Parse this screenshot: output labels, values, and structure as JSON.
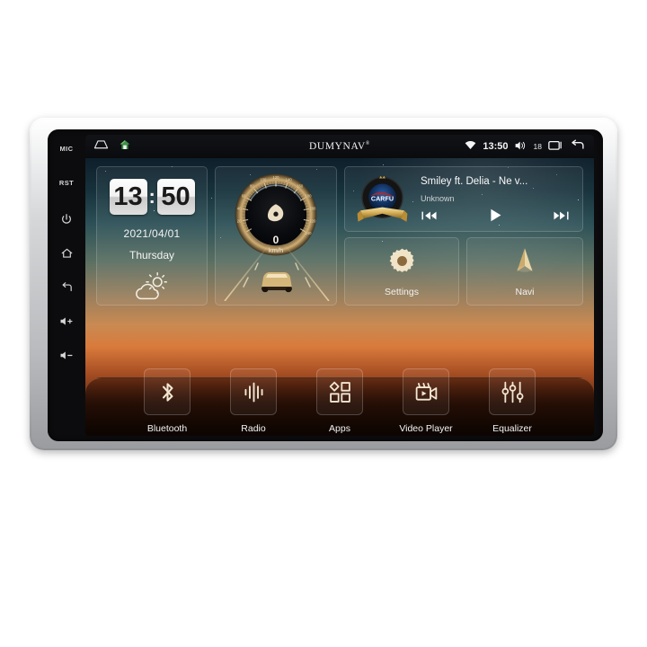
{
  "device": {
    "brand": "DUMYNAV",
    "brand_mark": "®"
  },
  "hardkeys": [
    {
      "name": "mic",
      "label": "MIC"
    },
    {
      "name": "reset",
      "label": "RST"
    },
    {
      "name": "power",
      "label": ""
    },
    {
      "name": "home",
      "label": ""
    },
    {
      "name": "back",
      "label": ""
    },
    {
      "name": "volume-up",
      "label": ""
    },
    {
      "name": "volume-down",
      "label": ""
    }
  ],
  "statusbar": {
    "left_icons": [
      "collapse-icon",
      "home-icon"
    ],
    "time": "13:50",
    "volume_level": "18",
    "right_icons": [
      "wifi-icon",
      "volume-icon",
      "recents-icon",
      "back-icon"
    ]
  },
  "clock_widget": {
    "hours": "13",
    "separator": ":",
    "minutes": "50",
    "date": "2021/04/01",
    "weekday": "Thursday",
    "weather_icon": "partly-cloudy-icon"
  },
  "speed_widget": {
    "value": "0",
    "unit": "km/h",
    "ticks": [
      "20",
      "40",
      "60",
      "80",
      "100",
      "120",
      "140",
      "160",
      "180",
      "200",
      "220",
      "240"
    ],
    "min": 0,
    "max": 240
  },
  "media_widget": {
    "title": "Smiley ft. Delia - Ne v...",
    "artist": "Unknown",
    "album_art_text": "CARFU",
    "controls": [
      {
        "name": "previous-track-button",
        "label": "Previous"
      },
      {
        "name": "play-button",
        "label": "Play"
      },
      {
        "name": "next-track-button",
        "label": "Next"
      }
    ]
  },
  "tiles": [
    {
      "name": "settings",
      "label": "Settings",
      "icon": "gear-icon"
    },
    {
      "name": "navi",
      "label": "Navi",
      "icon": "navigation-arrow-icon"
    }
  ],
  "dock": [
    {
      "name": "bluetooth",
      "label": "Bluetooth",
      "icon": "bluetooth-icon"
    },
    {
      "name": "radio",
      "label": "Radio",
      "icon": "radio-waves-icon"
    },
    {
      "name": "apps",
      "label": "Apps",
      "icon": "apps-grid-icon"
    },
    {
      "name": "video-player",
      "label": "Video Player",
      "icon": "video-camera-icon"
    },
    {
      "name": "equalizer",
      "label": "Equalizer",
      "icon": "equalizer-sliders-icon"
    }
  ],
  "colors": {
    "accent": "#f2e6d2",
    "bezel": "#d5d7d9",
    "screen_bg": "#0c0c0e"
  }
}
